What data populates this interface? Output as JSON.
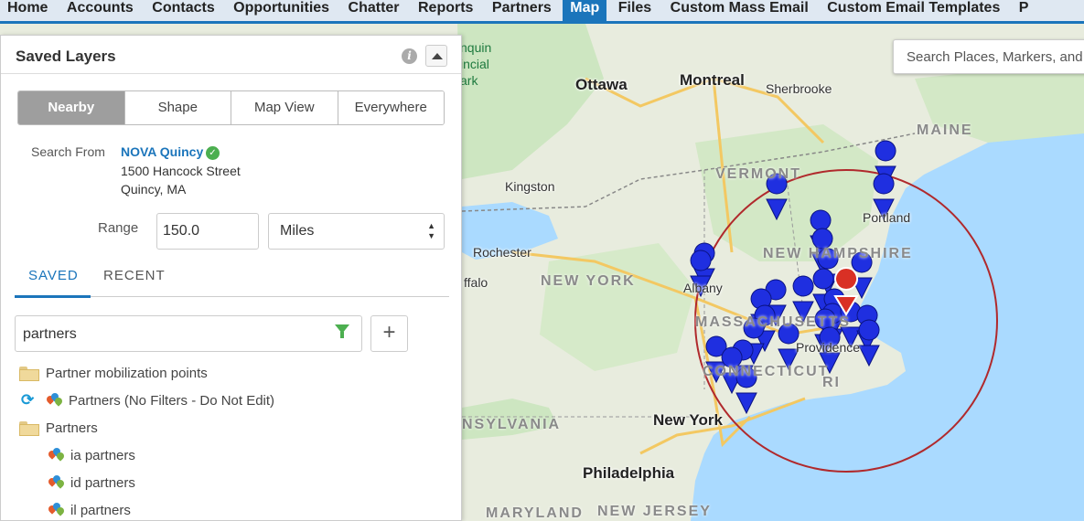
{
  "nav": {
    "tabs": [
      "Home",
      "Accounts",
      "Contacts",
      "Opportunities",
      "Chatter",
      "Reports",
      "Partners",
      "Map",
      "Files",
      "Custom Mass Email",
      "Custom Email Templates",
      "P"
    ],
    "active": "Map"
  },
  "map": {
    "search_placeholder": "Search Places, Markers, and",
    "labels": {
      "ottawa": "Ottawa",
      "montreal": "Montreal",
      "sherbrooke": "Sherbrooke",
      "maine": "MAINE",
      "vermont": "VERMONT",
      "kingston": "Kingston",
      "portland": "Portland",
      "new_hampshire": "NEW HAMPSHIRE",
      "rochester": "Rochester",
      "buffalo": "ffalo",
      "new_york_state": "NEW YORK",
      "albany": "Albany",
      "massachusetts": "MASSACHUSETTS",
      "providence": "Providence",
      "connecticut": "CONNECTICUT",
      "ri": "RI",
      "pennsylvania": "NSYLVANIA",
      "new_york_city": "New York",
      "philadelphia": "Philadelphia",
      "maryland": "MARYLAND",
      "new_jersey": "NEW JERSEY",
      "algonquin_1": "nquin",
      "algonquin_2": "incial",
      "algonquin_3": "ark"
    },
    "colors": {
      "water": "#aadaff",
      "land": "#e8ecde",
      "green": "#cde6c1",
      "radius_circle": "#b0292c",
      "marker": "#1f2fe0",
      "center_marker": "#d93025"
    }
  },
  "panel": {
    "title": "Saved Layers",
    "segments": [
      "Nearby",
      "Shape",
      "Map View",
      "Everywhere"
    ],
    "active_segment": "Nearby",
    "search_from_label": "Search From",
    "search_from_name": "NOVA Quincy",
    "address_line1": "1500 Hancock Street",
    "address_line2": "Quincy, MA",
    "range_label": "Range",
    "range_value": "150.0",
    "units": "Miles",
    "tabs": [
      "SAVED",
      "RECENT"
    ],
    "filter_value": "partners",
    "add_label": "+",
    "tree": [
      {
        "type": "folder",
        "label": "Partner mobilization points"
      },
      {
        "type": "layer-refresh",
        "label": "Partners (No Filters - Do Not Edit)"
      },
      {
        "type": "folder",
        "label": "Partners"
      },
      {
        "type": "layer",
        "label": "ia partners"
      },
      {
        "type": "layer",
        "label": "id partners"
      },
      {
        "type": "layer",
        "label": "il partners"
      }
    ]
  }
}
